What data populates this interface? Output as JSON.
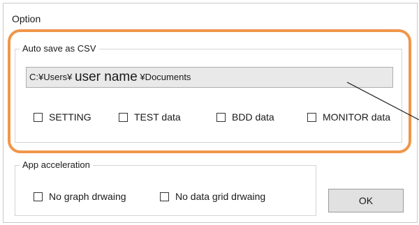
{
  "dialog": {
    "title": "Option"
  },
  "csv_group": {
    "caption": "Auto save as CSV",
    "path": {
      "prefix": "C:¥Users¥",
      "user": "user name",
      "suffix": "¥Documents"
    },
    "checkboxes": [
      {
        "label": "SETTING",
        "checked": false
      },
      {
        "label": "TEST data",
        "checked": false
      },
      {
        "label": "BDD data",
        "checked": false
      },
      {
        "label": "MONITOR data",
        "checked": false
      }
    ]
  },
  "accel_group": {
    "caption": "App acceleration",
    "checkboxes": [
      {
        "label": "No graph drwaing",
        "checked": false
      },
      {
        "label": "No data grid drwaing",
        "checked": false
      }
    ]
  },
  "buttons": {
    "ok_label": "OK"
  },
  "colors": {
    "highlight": "#f0964a",
    "field_background": "#e9e9e9",
    "button_background": "#e1e1e1"
  }
}
